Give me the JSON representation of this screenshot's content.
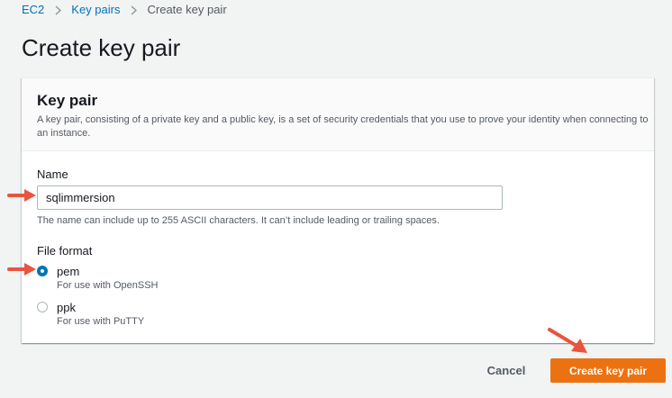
{
  "breadcrumb": {
    "items": [
      {
        "label": "EC2"
      },
      {
        "label": "Key pairs"
      },
      {
        "label": "Create key pair"
      }
    ]
  },
  "page": {
    "title": "Create key pair"
  },
  "panel": {
    "title": "Key pair",
    "description": "A key pair, consisting of a private key and a public key, is a set of security credentials that you use to prove your identity when connecting to an instance."
  },
  "name_field": {
    "label": "Name",
    "value": "sqlimmersion",
    "constraint": "The name can include up to 255 ASCII characters. It can’t include leading or trailing spaces."
  },
  "file_format": {
    "label": "File format",
    "selected": "pem",
    "options": [
      {
        "value": "pem",
        "label": "pem",
        "description": "For use with OpenSSH"
      },
      {
        "value": "ppk",
        "label": "ppk",
        "description": "For use with PuTTY"
      }
    ]
  },
  "actions": {
    "cancel_label": "Cancel",
    "create_label": "Create key pair"
  },
  "colors": {
    "primary_button": "#ec7211",
    "link": "#0073bb",
    "annotation_arrow": "#e8553e"
  },
  "icons": {
    "breadcrumb_separator": "chevron-right-icon",
    "annotation": "red-arrow-icon"
  }
}
